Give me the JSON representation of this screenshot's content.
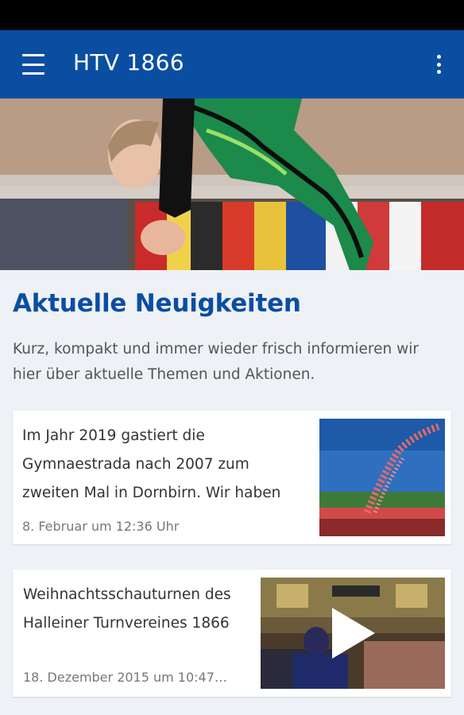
{
  "app_bar": {
    "title": "HTV 1866",
    "menu_icon": "hamburger-menu-icon",
    "overflow_icon": "more-vert-icon",
    "color": "#0a4ea2"
  },
  "hero": {
    "image": "gymnast-performing-photo"
  },
  "section": {
    "title": "Aktuelle Neuigkeiten",
    "description": "Kurz, kompakt und immer wieder frisch informieren wir hier über aktuelle Themen und Aktionen."
  },
  "news": [
    {
      "text": "Im Jahr 2019 gastiert die Gymnaestrada nach 2007 zum zweiten Mal in Dornbirn. Wir haben",
      "date": "8. Februar um 12:36 Uhr",
      "thumbnail": "stadium-balloons-photo"
    },
    {
      "text": "Weihnachtsschauturnen des Halleiner Turnvereines 1866",
      "date": "18. Dezember 2015 um 10:47…",
      "thumbnail": "gym-hall-video-thumbnail",
      "has_video": true
    }
  ]
}
